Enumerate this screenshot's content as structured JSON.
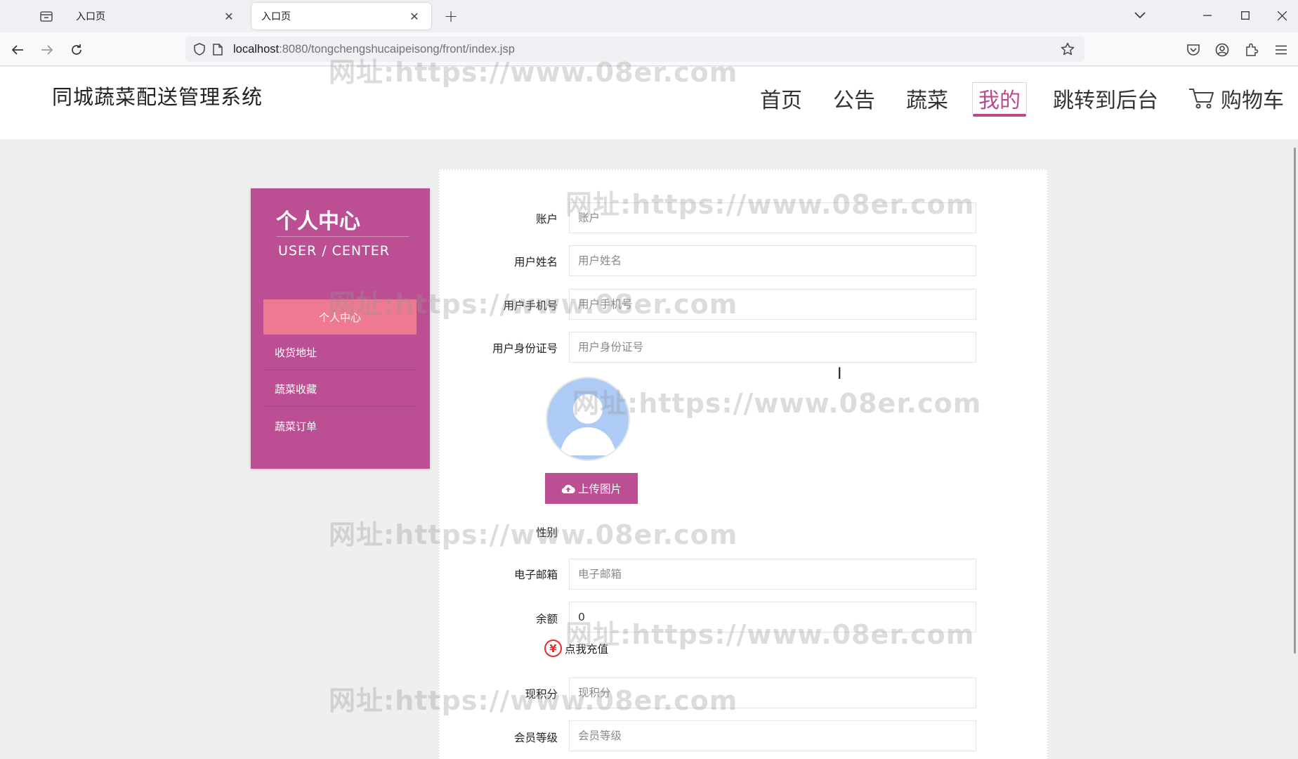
{
  "browser": {
    "tabs": [
      {
        "title": "入口页",
        "active": false
      },
      {
        "title": "入口页",
        "active": true
      }
    ],
    "url_host": "localhost",
    "url_rest": ":8080/tongchengshucaipeisong/front/index.jsp"
  },
  "site": {
    "title": "同城蔬菜配送管理系统",
    "menu": [
      {
        "label": "首页",
        "active": false
      },
      {
        "label": "公告",
        "active": false
      },
      {
        "label": "蔬菜",
        "active": false
      },
      {
        "label": "我的",
        "active": true
      },
      {
        "label": "跳转到后台",
        "active": false
      },
      {
        "label": "购物车",
        "active": false
      }
    ]
  },
  "user_panel": {
    "title": "个人中心",
    "subtitle": "USER / CENTER",
    "items": [
      {
        "label": "个人中心",
        "active": true
      },
      {
        "label": "收货地址",
        "active": false
      },
      {
        "label": "蔬菜收藏",
        "active": false
      },
      {
        "label": "蔬菜订单",
        "active": false
      }
    ]
  },
  "form": {
    "account": {
      "label": "账户",
      "placeholder": "账户",
      "value": ""
    },
    "name": {
      "label": "用户姓名",
      "placeholder": "用户姓名",
      "value": ""
    },
    "phone": {
      "label": "用户手机号",
      "placeholder": "用户手机号",
      "value": ""
    },
    "id_card": {
      "label": "用户身份证号",
      "placeholder": "用户身份证号",
      "value": ""
    },
    "upload_label": "上传图片",
    "gender_label": "性别",
    "email": {
      "label": "电子邮箱",
      "placeholder": "电子邮箱",
      "value": ""
    },
    "balance": {
      "label": "余额",
      "placeholder": "",
      "value": "0"
    },
    "recharge_label": "点我充值",
    "recharge_symbol": "¥",
    "points": {
      "label": "现积分",
      "placeholder": "现积分",
      "value": ""
    },
    "level": {
      "label": "会员等级",
      "placeholder": "会员等级",
      "value": ""
    }
  },
  "watermark": "网址:https://www.08er.com",
  "colors": {
    "brand": "#bc4f93",
    "active_item": "#ee7a92",
    "recharge_icon": "#e02f2f"
  }
}
